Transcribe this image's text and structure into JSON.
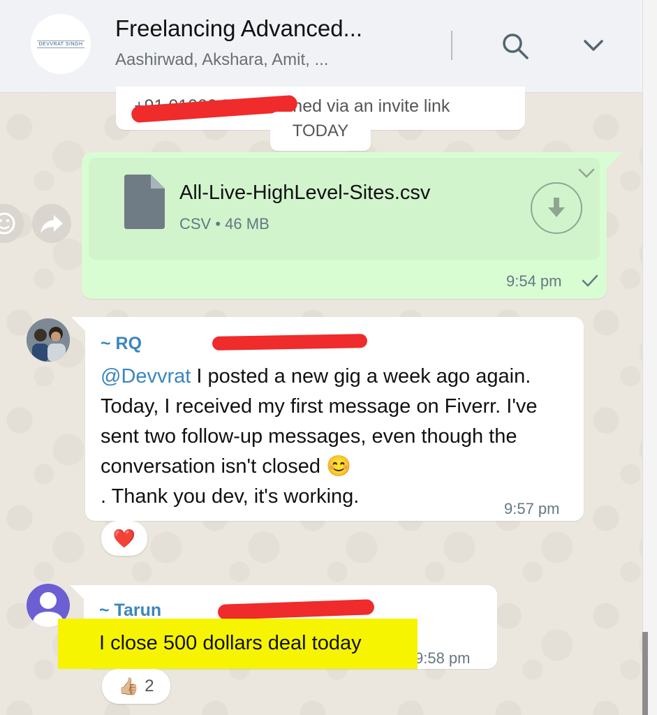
{
  "header": {
    "group_logo_text": "DEVVRAT SINGH",
    "title": "Freelancing Advanced...",
    "subtitle": "Aashirwad, Akshara, Amit, ..."
  },
  "system_message": {
    "text": "+91 01000 51000 joined via an invite link"
  },
  "date_chip": "TODAY",
  "outgoing_file": {
    "file_name": "All-Live-HighLevel-Sites.csv",
    "file_meta": "CSV • 46 MB",
    "time": "9:54 pm"
  },
  "message_rq": {
    "sender": "~ RQ",
    "mention": "@Devvrat",
    "text": " I posted a new gig a week ago again. Today, I received my first message on Fiverr. I've sent two follow-up messages, even though the conversation isn't closed",
    "emoji": "😊",
    "text_end": ". Thank you dev, it's working.",
    "time": "9:57 pm",
    "reaction": "❤️"
  },
  "message_tarun": {
    "sender": "~ Tarun",
    "text": "I close 500 dollars deal today",
    "time": "9:58 pm",
    "reaction": "👍🏼",
    "reaction_count": "2"
  },
  "colors": {
    "outgoing_bubble": "#d9fdd3",
    "sender_name": "#3a86bf",
    "highlight": "#f6f400",
    "redaction": "#ef2b2b"
  }
}
